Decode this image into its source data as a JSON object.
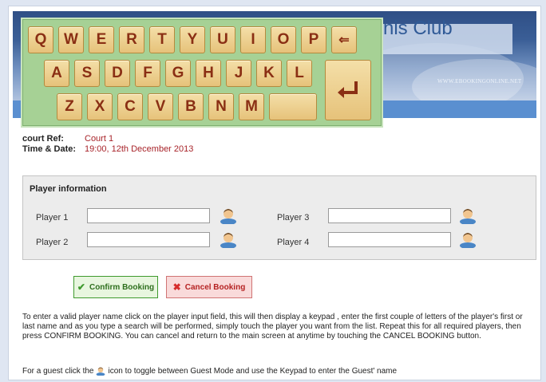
{
  "header": {
    "club_title": "nis Club",
    "site_url": "WWW.EBOOKINGONLINE.NET"
  },
  "keyboard": {
    "row1": [
      "Q",
      "W",
      "E",
      "R",
      "T",
      "Y",
      "U",
      "I",
      "O",
      "P",
      "⇐"
    ],
    "row2": [
      "A",
      "S",
      "D",
      "F",
      "G",
      "H",
      "J",
      "K",
      "L"
    ],
    "row3": [
      "Z",
      "X",
      "C",
      "V",
      "B",
      "N",
      "M",
      ""
    ],
    "enter_icon": "enter-arrow-icon",
    "backspace_icon": "backspace-arrow-icon"
  },
  "court": {
    "ref_label": "court Ref:",
    "ref_value": "Court 1",
    "time_label": "Time & Date:",
    "time_value": "19:00, 12th December 2013"
  },
  "players": {
    "title": "Player information",
    "list": [
      {
        "label": "Player 1",
        "value": ""
      },
      {
        "label": "Player 2",
        "value": ""
      },
      {
        "label": "Player 3",
        "value": ""
      },
      {
        "label": "Player 4",
        "value": ""
      }
    ],
    "icon": "guest-person-icon"
  },
  "buttons": {
    "confirm": "Confirm Booking",
    "cancel": "Cancel Booking"
  },
  "help": {
    "main": "To enter a valid player name click on the player input field, this will then display a keypad , enter the first couple of letters of the player's first or last name and as you type a search will be performed, simply touch the player you want from the list. Repeat this for all required players, then press CONFIRM BOOKING. You can cancel and return to the main screen at anytime by touching the CANCEL BOOKING button.",
    "guest_before": "For a guest click the",
    "guest_after": "icon to toggle between Guest Mode and use the Keypad to enter the Guest' name"
  },
  "colors": {
    "keyboard_bg": "#a6d195",
    "key_text": "#8a2f14",
    "court_value": "#a8242a",
    "header_bar": "#5a8fd0",
    "confirm_border": "#3f9a2e",
    "cancel_border": "#d07474"
  }
}
